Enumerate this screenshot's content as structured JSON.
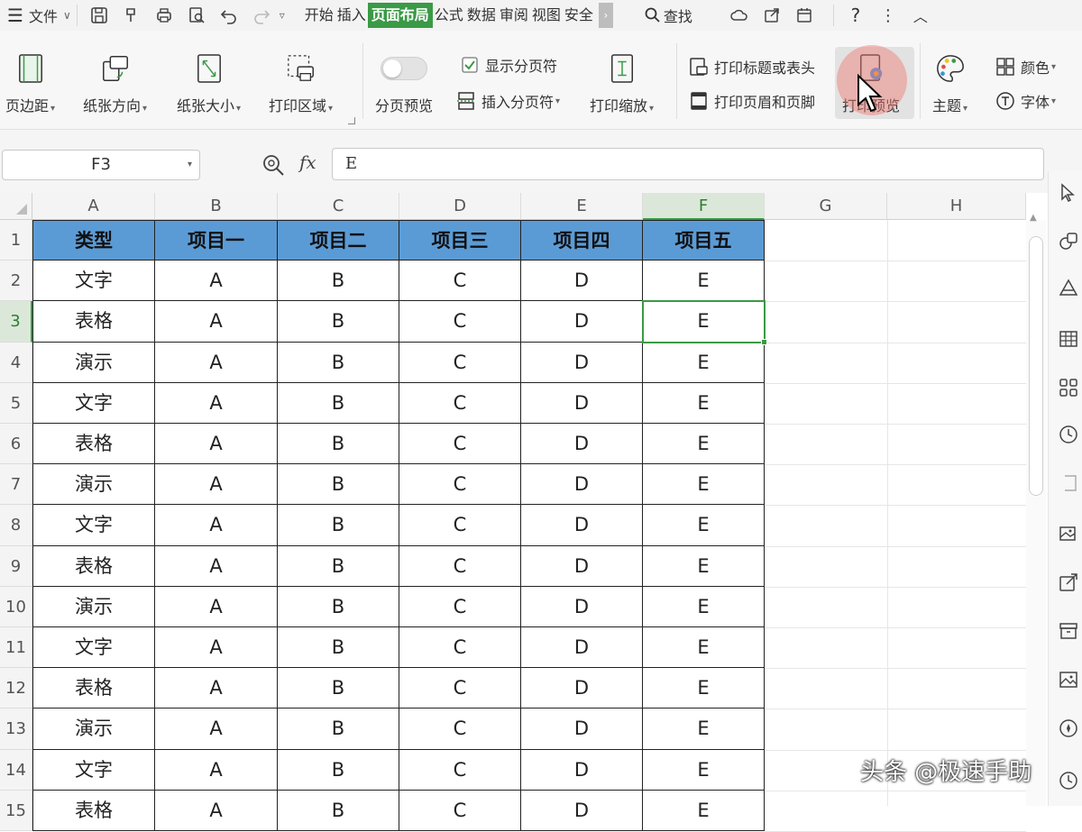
{
  "menubar": {
    "file_label": "文件",
    "tabs": [
      "开始",
      "插入",
      "页面布局",
      "公式",
      "数据",
      "审阅",
      "视图",
      "安全"
    ],
    "active_tab": "页面布局",
    "search_label": "查找"
  },
  "ribbon": {
    "margins": "页边距",
    "orientation": "纸张方向",
    "size": "纸张大小",
    "print_area": "打印区域",
    "page_break_preview": "分页预览",
    "show_page_breaks": "显示分页符",
    "insert_page_break": "插入分页符",
    "print_scaling": "打印缩放",
    "print_titles": "打印标题或表头",
    "print_header_footer": "打印页眉和页脚",
    "print_preview": "打印预览",
    "theme": "主题",
    "colors": "颜色",
    "fonts": "字体"
  },
  "formula_bar": {
    "name_box": "F3",
    "fx": "fx",
    "value": "E"
  },
  "sheet": {
    "columns": [
      "A",
      "B",
      "C",
      "D",
      "E",
      "F",
      "G",
      "H"
    ],
    "rows": [
      "1",
      "2",
      "3",
      "4",
      "5",
      "6",
      "7",
      "8",
      "9",
      "10",
      "11",
      "12",
      "13",
      "14",
      "15"
    ],
    "selected_column": "F",
    "selected_row": "3",
    "header": [
      "类型",
      "项目一",
      "项目二",
      "项目三",
      "项目四",
      "项目五"
    ],
    "data": [
      [
        "文字",
        "A",
        "B",
        "C",
        "D",
        "E"
      ],
      [
        "表格",
        "A",
        "B",
        "C",
        "D",
        "E"
      ],
      [
        "演示",
        "A",
        "B",
        "C",
        "D",
        "E"
      ],
      [
        "文字",
        "A",
        "B",
        "C",
        "D",
        "E"
      ],
      [
        "表格",
        "A",
        "B",
        "C",
        "D",
        "E"
      ],
      [
        "演示",
        "A",
        "B",
        "C",
        "D",
        "E"
      ],
      [
        "文字",
        "A",
        "B",
        "C",
        "D",
        "E"
      ],
      [
        "表格",
        "A",
        "B",
        "C",
        "D",
        "E"
      ],
      [
        "演示",
        "A",
        "B",
        "C",
        "D",
        "E"
      ],
      [
        "文字",
        "A",
        "B",
        "C",
        "D",
        "E"
      ],
      [
        "表格",
        "A",
        "B",
        "C",
        "D",
        "E"
      ],
      [
        "演示",
        "A",
        "B",
        "C",
        "D",
        "E"
      ],
      [
        "文字",
        "A",
        "B",
        "C",
        "D",
        "E"
      ],
      [
        "表格",
        "A",
        "B",
        "C",
        "D",
        "E"
      ]
    ]
  },
  "watermark": "头条 @极速手助",
  "colors": {
    "accent": "#3a9a45",
    "header_fill": "#5b9bd5"
  }
}
